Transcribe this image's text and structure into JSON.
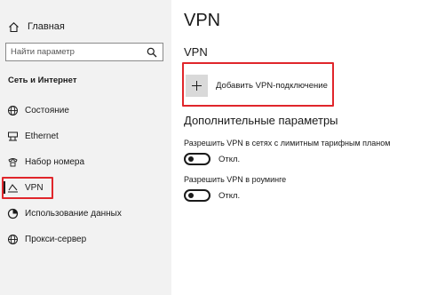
{
  "sidebar": {
    "home_label": "Главная",
    "search_placeholder": "Найти параметр",
    "section_title": "Сеть и Интернет",
    "items": [
      {
        "label": "Состояние",
        "icon": "globe-icon"
      },
      {
        "label": "Ethernet",
        "icon": "ethernet-icon"
      },
      {
        "label": "Набор номера",
        "icon": "phone-icon"
      },
      {
        "label": "VPN",
        "icon": "vpn-icon",
        "selected": true
      },
      {
        "label": "Использование данных",
        "icon": "data-usage-icon"
      },
      {
        "label": "Прокси-сервер",
        "icon": "globe-icon"
      }
    ]
  },
  "main": {
    "title": "VPN",
    "vpn_section": "VPN",
    "add_vpn_label": "Добавить VPN-подключение",
    "advanced_title": "Дополнительные параметры",
    "options": [
      {
        "label": "Разрешить VPN в сетях с лимитным тарифным планом",
        "state": "Откл."
      },
      {
        "label": "Разрешить VPN в роуминге",
        "state": "Откл."
      }
    ]
  },
  "colors": {
    "highlight": "#e0262b",
    "sidebar_bg": "#f2f2f2",
    "text": "#1a1a1a"
  }
}
